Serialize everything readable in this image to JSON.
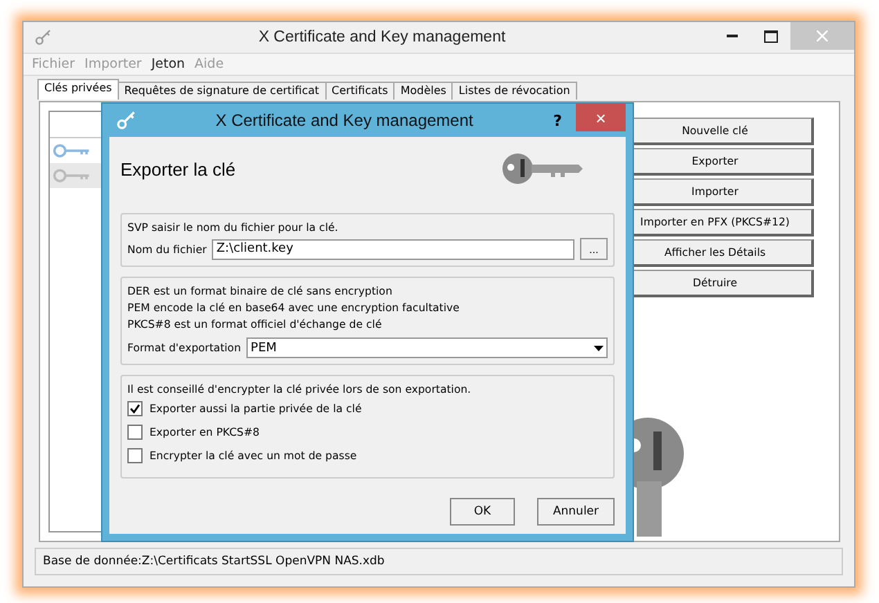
{
  "window": {
    "title": "X Certificate and Key management"
  },
  "menu": [
    {
      "label": "Fichier",
      "disabled": true
    },
    {
      "label": "Importer",
      "disabled": true
    },
    {
      "label": "Jeton",
      "disabled": false
    },
    {
      "label": "Aide",
      "disabled": true
    }
  ],
  "tabs": [
    {
      "label": "Clés privées",
      "selected": true
    },
    {
      "label": "Requêtes de signature de certificat",
      "selected": false
    },
    {
      "label": "Certificats",
      "selected": false
    },
    {
      "label": "Modèles",
      "selected": false
    },
    {
      "label": "Listes de révocation",
      "selected": false
    }
  ],
  "key_list": [
    {
      "selected": true
    },
    {
      "selected": false
    }
  ],
  "actions": [
    "Nouvelle clé",
    "Exporter",
    "Importer",
    "Importer en PFX (PKCS#12)",
    "Afficher les Détails",
    "Détruire"
  ],
  "status_bar": "Base de donnée:Z:\\Certificats StartSSL OpenVPN NAS.xdb",
  "dialog": {
    "title": "X Certificate and Key management",
    "help": "?",
    "close": "×",
    "heading": "Exporter la clé",
    "file_group": {
      "hint": "SVP saisir le nom du fichier pour la clé.",
      "label": "Nom du fichier",
      "value": "Z:\\client.key",
      "browse": "..."
    },
    "format_group": {
      "lines": [
        "DER est un format binaire de clé sans encryption",
        "PEM encode la clé en base64 avec une encryption facultative",
        "PKCS#8 est un format officiel d'échange de clé"
      ],
      "label": "Format d'exportation",
      "value": "PEM"
    },
    "options_group": {
      "hint": "Il est conseillé d'encrypter la clé privée lors de son exportation.",
      "options": [
        {
          "label": "Exporter aussi la partie privée de la clé",
          "checked": true
        },
        {
          "label": "Exporter en PKCS#8",
          "checked": false
        },
        {
          "label": "Encrypter la clé avec un mot de passe",
          "checked": false
        }
      ]
    },
    "buttons": [
      "OK",
      "Annuler"
    ]
  }
}
